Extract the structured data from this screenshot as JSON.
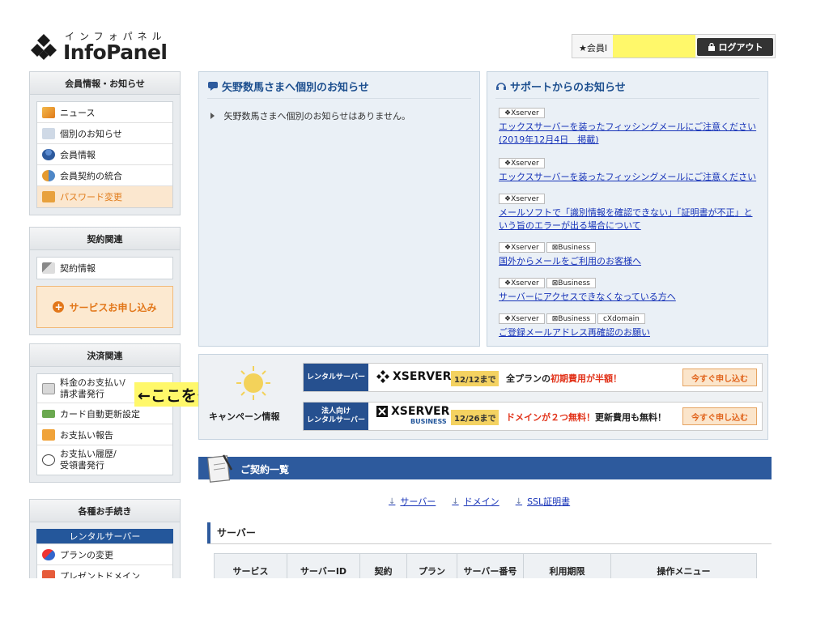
{
  "header": {
    "logo_kana": "インフォパネル",
    "logo_name": "InfoPanel",
    "member_label": "★会員I",
    "logout_label": "ログアウト"
  },
  "sidebar": {
    "member": {
      "title": "会員情報・お知らせ",
      "items": [
        {
          "label": "ニュース",
          "icon": "megaphone-icon"
        },
        {
          "label": "個別のお知らせ",
          "icon": "notice-icon"
        },
        {
          "label": "会員情報",
          "icon": "user-icon"
        },
        {
          "label": "会員契約の統合",
          "icon": "users-icon"
        },
        {
          "label": "パスワード変更",
          "icon": "lock-icon"
        }
      ]
    },
    "contract": {
      "title": "契約関連",
      "items": [
        {
          "label": "契約情報",
          "icon": "pen-icon"
        }
      ],
      "apply_label": "サービスお申し込み"
    },
    "payment": {
      "title": "決済関連",
      "items": [
        {
          "label": "料金のお支払い/",
          "label2": "請求書発行",
          "icon": "document-icon"
        },
        {
          "label": "カード自動更新設定",
          "icon": "card-icon"
        },
        {
          "label": "お支払い報告",
          "icon": "chat-icon"
        },
        {
          "label": "お支払い履歴/",
          "label2": "受領書発行",
          "icon": "clock-icon"
        }
      ]
    },
    "procedures": {
      "title": "各種お手続き",
      "sub_head": "レンタルサーバー",
      "items": [
        {
          "label": "プランの変更",
          "icon": "refresh-icon"
        },
        {
          "label": "プレゼントドメイン",
          "icon": "gift-icon"
        }
      ]
    }
  },
  "callout": "←ここをクリック",
  "notice": {
    "title": "矢野数馬さまへ個別のお知らせ",
    "text": "矢野数馬さまへ個別のお知らせはありません。"
  },
  "support": {
    "title": "サポートからのお知らせ",
    "items": [
      {
        "tags": [
          "❖Xserver"
        ],
        "link": "エックスサーバーを装ったフィッシングメールにご注意ください",
        "link2": "(2019年12月4日　掲載)"
      },
      {
        "tags": [
          "❖Xserver"
        ],
        "link": "エックスサーバーを装ったフィッシングメールにご注意ください"
      },
      {
        "tags": [
          "❖Xserver"
        ],
        "link": "メールソフトで「識別情報を確認できない」「証明書が不正」と",
        "link2": "いう旨のエラーが出る場合について"
      },
      {
        "tags": [
          "❖Xserver",
          "⊠Business"
        ],
        "link": "国外からメールをご利用のお客様へ"
      },
      {
        "tags": [
          "❖Xserver",
          "⊠Business"
        ],
        "link": "サーバーにアクセスできなくなっている方へ"
      },
      {
        "tags": [
          "❖Xserver",
          "⊠Business",
          "ᴄXdomain"
        ],
        "link": "ご登録メールアドレス再確認のお願い"
      }
    ]
  },
  "campaign": {
    "label": "キャンペーン情報",
    "rows": [
      {
        "tag": "レンタルサーバー",
        "brand": "XSERVER",
        "brand_sub": "",
        "date": "12/12まで",
        "msg_a": "全プランの",
        "msg_red": "初期費用が半額！",
        "msg_b": "",
        "button": "今すぐ申し込む"
      },
      {
        "tag": "法人向け\nレンタルサーバー",
        "brand": "XSERVER",
        "brand_sub": "BUSINESS",
        "date": "12/26まで",
        "msg_a": "",
        "msg_red": "ドメインが２つ無料！",
        "msg_b": "更新費用も無料！",
        "button": "今すぐ申し込む"
      }
    ]
  },
  "contracts": {
    "title": "ご契約一覧",
    "anchors": [
      "サーバー",
      "ドメイン",
      "SSL証明書"
    ],
    "server_head": "サーバー",
    "columns": [
      "サービス",
      "サーバーID",
      "契約",
      "プラン",
      "サーバー番号",
      "利用期限",
      "操作メニュー"
    ]
  },
  "colors": {
    "brand_blue": "#2d5a9d",
    "link": "#1733b8",
    "accent_orange": "#e2771a",
    "highlight": "#fff86a"
  }
}
